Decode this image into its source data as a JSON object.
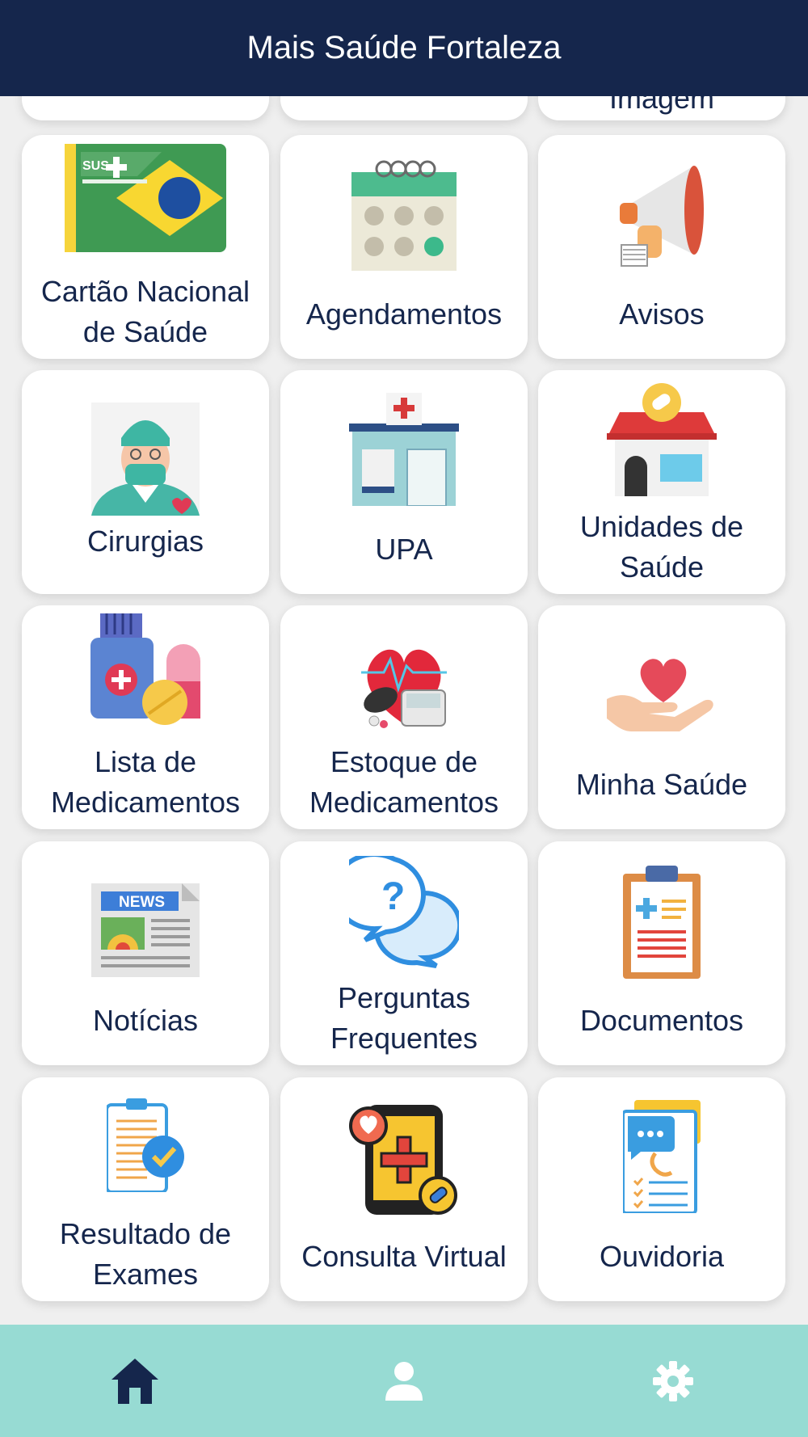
{
  "header": {
    "title": "Mais Saúde Fortaleza"
  },
  "partial_row": [
    "",
    "",
    "Imagem"
  ],
  "tiles": [
    {
      "label": "Cartão Nacional de Saúde",
      "icon": "sus-card-icon"
    },
    {
      "label": "Agendamentos",
      "icon": "calendar-icon"
    },
    {
      "label": "Avisos",
      "icon": "megaphone-icon"
    },
    {
      "label": "Cirurgias",
      "icon": "surgeon-icon"
    },
    {
      "label": "UPA",
      "icon": "emergency-unit-icon"
    },
    {
      "label": "Unidades de Saúde",
      "icon": "health-unit-icon"
    },
    {
      "label": "Lista de Medicamentos",
      "icon": "medicine-bottle-icon"
    },
    {
      "label": "Estoque de Medicamentos",
      "icon": "blood-pressure-monitor-icon"
    },
    {
      "label": "Minha Saúde",
      "icon": "heart-hand-icon"
    },
    {
      "label": "Notícias",
      "icon": "newspaper-icon"
    },
    {
      "label": "Perguntas Frequentes",
      "icon": "faq-bubbles-icon"
    },
    {
      "label": "Documentos",
      "icon": "clipboard-document-icon"
    },
    {
      "label": "Resultado de Exames",
      "icon": "exam-result-icon"
    },
    {
      "label": "Consulta Virtual",
      "icon": "virtual-consultation-phone-icon"
    },
    {
      "label": "Ouvidoria",
      "icon": "ombudsman-icon"
    }
  ],
  "bottom_nav": [
    {
      "name": "home",
      "icon": "home-icon",
      "active": true
    },
    {
      "name": "profile",
      "icon": "user-icon",
      "active": false
    },
    {
      "name": "settings",
      "icon": "gear-icon",
      "active": false
    }
  ],
  "colors": {
    "header": "#15264c",
    "text": "#15264c",
    "nav": "#97dbd3",
    "background": "#efefef"
  }
}
